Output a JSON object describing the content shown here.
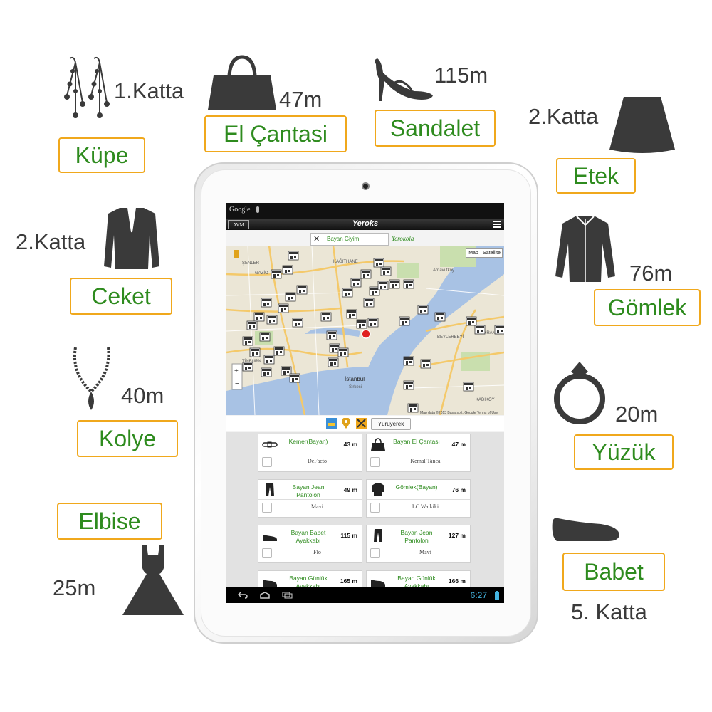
{
  "callouts": {
    "kupe": {
      "label": "Küpe",
      "note": "1.Katta",
      "icon": "earrings-icon"
    },
    "el_cantasi": {
      "label": "El Çantasi",
      "note": "47m",
      "icon": "handbag-icon"
    },
    "sandalet": {
      "label": "Sandalet",
      "note": "115m",
      "icon": "sandal-icon"
    },
    "etek": {
      "label": "Etek",
      "note": "2.Katta",
      "icon": "skirt-icon"
    },
    "ceket": {
      "label": "Ceket",
      "note": "2.Katta",
      "icon": "jacket-icon"
    },
    "gomlek": {
      "label": "Gömlek",
      "note": "76m",
      "icon": "shirt-icon"
    },
    "kolye": {
      "label": "Kolye",
      "note": "40m",
      "icon": "necklace-icon"
    },
    "yuzuk": {
      "label": "Yüzük",
      "note": "20m",
      "icon": "ring-icon"
    },
    "elbise": {
      "label": "Elbise",
      "note": "25m",
      "icon": "dress-icon"
    },
    "babet": {
      "label": "Babet",
      "note": "5. Katta",
      "icon": "flat-shoe-icon"
    }
  },
  "app": {
    "google_label": "Google",
    "avm_button": "AVM",
    "title": "Yeroks",
    "filter_label": "Bayan Giyim",
    "brand": "Yerokola",
    "map_button": "Map",
    "satellite_button": "Satellite",
    "walk_button": "Yürüyerek",
    "clock": "6:27"
  },
  "map_labels": {
    "senler": "ŞENLER",
    "gazio": "GAZİO",
    "kagithane": "KAĞITHANE",
    "arnavutkoy": "Arnavutköy",
    "istanbul": "İstanbul",
    "sirkeci": "Sirkeci",
    "beylerbeyi": "BEYLERBEYİ",
    "umraniye": "ÜMRANİYE",
    "kadikoy": "KADIKÖY",
    "zeytinburnu": "TİNBURN",
    "attribution": "Map data ©2013 Basarsoft, Google   Terms of Use"
  },
  "results": [
    {
      "name": "Kemer(Bayan)",
      "distance": "43 m",
      "store": "DeFacto",
      "icon": "belt-icon"
    },
    {
      "name": "Bayan El Çantası",
      "distance": "47 m",
      "store": "Kemal Tanca",
      "icon": "handbag-icon"
    },
    {
      "name": "Bayan Jean Pantolon",
      "distance": "49 m",
      "store": "Mavi",
      "icon": "pants-icon"
    },
    {
      "name": "Gömlek(Bayan)",
      "distance": "76 m",
      "store": "LC Waikiki",
      "icon": "shirt-icon"
    },
    {
      "name": "Bayan Babet Ayakkabı",
      "distance": "115 m",
      "store": "Flo",
      "icon": "flat-shoe-icon"
    },
    {
      "name": "Bayan Jean Pantolon",
      "distance": "127 m",
      "store": "Mavi",
      "icon": "pants-icon"
    },
    {
      "name": "Bayan Günlük Ayakkabı",
      "distance": "165 m",
      "store": "",
      "icon": "shoe-icon"
    },
    {
      "name": "Bayan Günlük Ayakkabı",
      "distance": "166 m",
      "store": "",
      "icon": "shoe-icon"
    }
  ],
  "colors": {
    "accent_border": "#f0a81c",
    "label_green": "#2e8b1e",
    "icon_dark": "#3a3a3a",
    "clock_blue": "#44b4e0"
  }
}
